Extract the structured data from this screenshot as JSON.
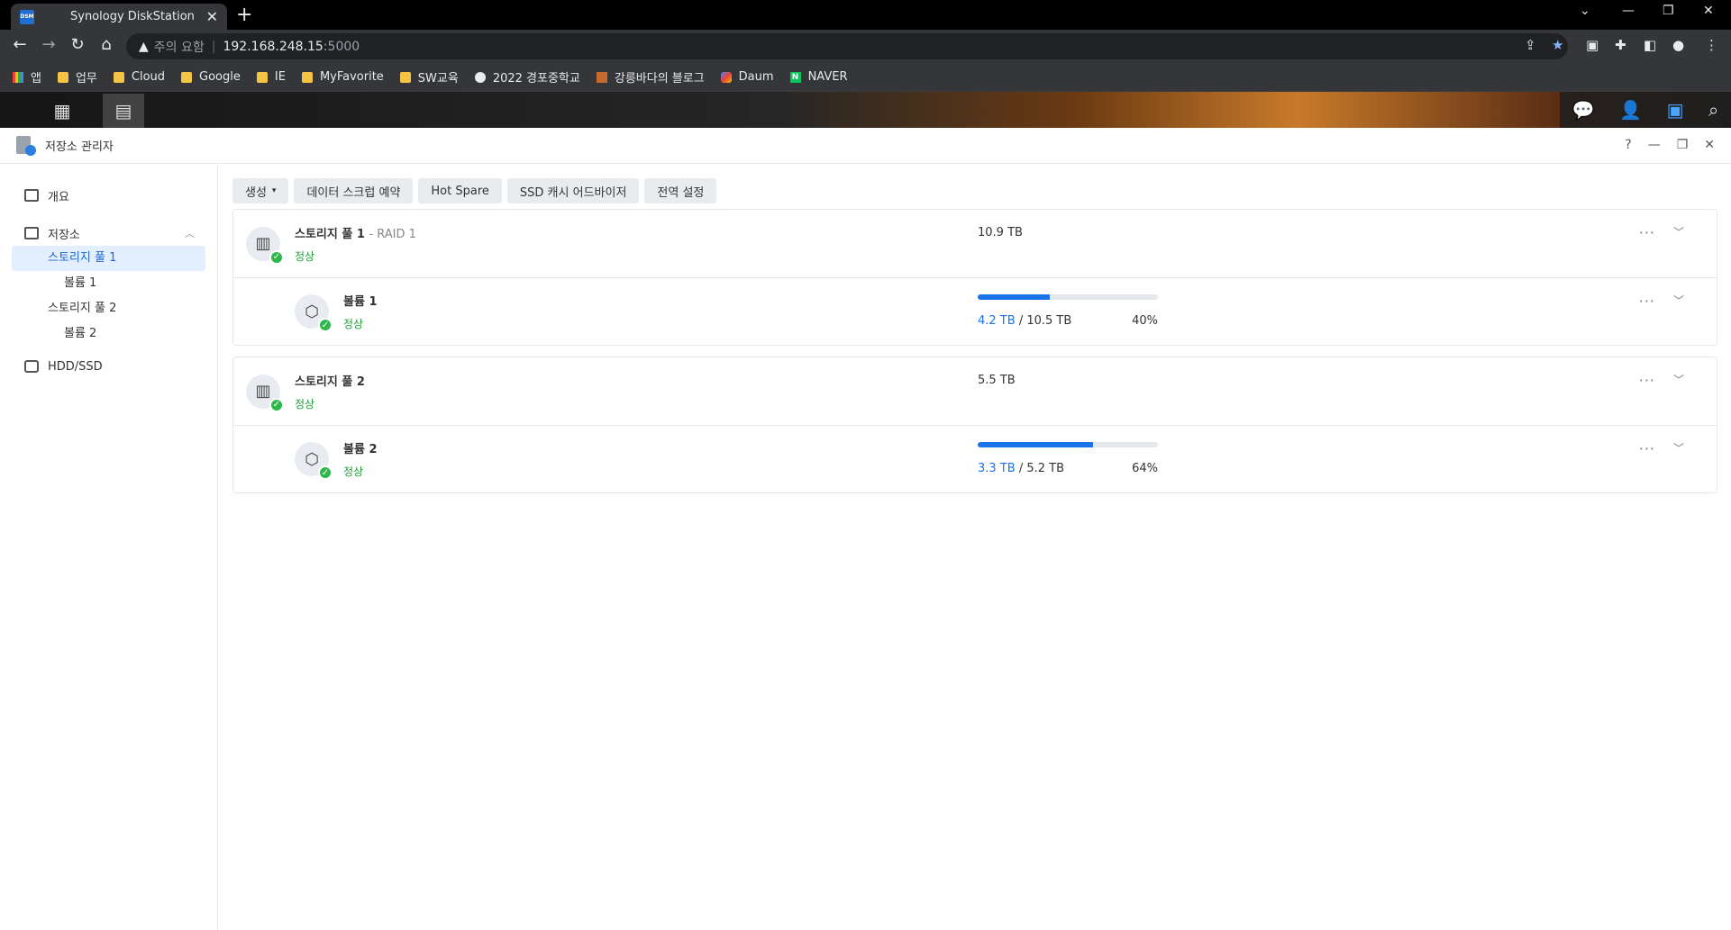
{
  "browser": {
    "tab_title": "Synology DiskStation",
    "favicon_text": "DSM",
    "security_label": "주의 요함",
    "url_host": "192.168.248.15",
    "url_port": ":5000",
    "bookmarks": [
      {
        "label": "앱",
        "icon": "apps-grid-icon"
      },
      {
        "label": "업무",
        "icon": "folder-icon"
      },
      {
        "label": "Cloud",
        "icon": "folder-icon"
      },
      {
        "label": "Google",
        "icon": "folder-icon"
      },
      {
        "label": "IE",
        "icon": "folder-icon"
      },
      {
        "label": "MyFavorite",
        "icon": "folder-icon"
      },
      {
        "label": "SW교육",
        "icon": "folder-icon"
      },
      {
        "label": "2022 경포중학교",
        "icon": "globe-icon"
      },
      {
        "label": "강릉바다의 블로그",
        "icon": "blog-icon"
      },
      {
        "label": "Daum",
        "icon": "daum-icon"
      },
      {
        "label": "NAVER",
        "icon": "naver-icon"
      }
    ]
  },
  "window": {
    "title": "저장소 관리자"
  },
  "sidebar": {
    "overview": "개요",
    "storage": "저장소",
    "pool1": "스토리지 풀 1",
    "vol1": "볼륨 1",
    "pool2": "스토리지 풀 2",
    "vol2": "볼륨 2",
    "hdd": "HDD/SSD"
  },
  "toolbar": {
    "create": "생성",
    "scrub": "데이터 스크럽 예약",
    "hotspare": "Hot Spare",
    "ssd": "SSD 캐시 어드바이저",
    "global": "전역 설정"
  },
  "pools": [
    {
      "name": "스토리지 풀 1",
      "raid": "- RAID 1",
      "status": "정상",
      "capacity": "10.9 TB",
      "volume": {
        "name": "볼륨 1",
        "status": "정상",
        "used": "4.2 TB",
        "total": "/ 10.5 TB",
        "percent": "40%",
        "fraction": 0.4
      }
    },
    {
      "name": "스토리지 풀 2",
      "raid": "",
      "status": "정상",
      "capacity": "5.5 TB",
      "volume": {
        "name": "볼륨 2",
        "status": "정상",
        "used": "3.3 TB",
        "total": "/ 5.2 TB",
        "percent": "64%",
        "fraction": 0.64
      }
    }
  ]
}
